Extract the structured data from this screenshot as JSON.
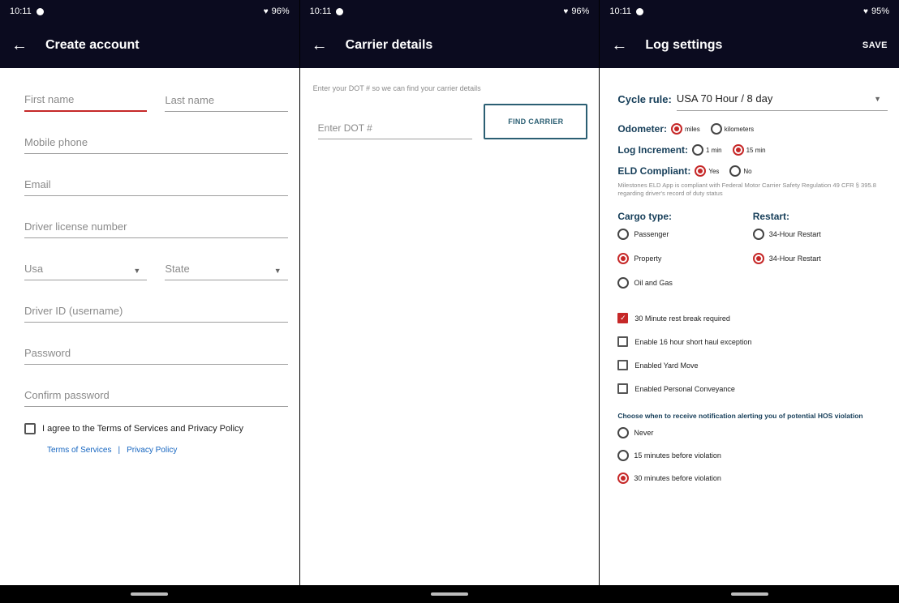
{
  "status": {
    "time": "10:11",
    "battery": "96%",
    "battery3": "95%"
  },
  "screens": {
    "create_account": {
      "title": "Create account",
      "fields": {
        "first_name": "First name",
        "last_name": "Last name",
        "mobile_phone": "Mobile phone",
        "email": "Email",
        "driver_license": "Driver license number",
        "country": "Usa",
        "state": "State",
        "driver_id": "Driver ID (username)",
        "password": "Password",
        "confirm_password": "Confirm password"
      },
      "agree_text": "I agree to the Terms of Services and Privacy Policy",
      "links": {
        "terms": "Terms of Services",
        "privacy": "Privacy Policy"
      }
    },
    "carrier": {
      "title": "Carrier details",
      "hint": "Enter your DOT # so we can find your carrier details",
      "dot_placeholder": "Enter DOT #",
      "find_button": "FIND CARRIER"
    },
    "log_settings": {
      "title": "Log settings",
      "save": "SAVE",
      "cycle_rule_label": "Cycle rule:",
      "cycle_rule_value": "USA 70 Hour / 8 day",
      "odometer": {
        "label": "Odometer:",
        "options": [
          "miles",
          "kilometers"
        ],
        "selected": "miles"
      },
      "increment": {
        "label": "Log Increment:",
        "options": [
          "1 min",
          "15 min"
        ],
        "selected": "15 min"
      },
      "eld": {
        "label": "ELD Compliant:",
        "options": [
          "Yes",
          "No"
        ],
        "selected": "Yes"
      },
      "eld_note": "Milestones ELD App is compliant with Federal Motor Carrier Safety Regulation 49 CFR § 395.8 regarding driver's record of duty status",
      "cargo": {
        "label": "Cargo type:",
        "options": [
          "Passenger",
          "Property",
          "Oil and Gas"
        ],
        "selected": "Property"
      },
      "restart": {
        "label": "Restart:",
        "options": [
          "34-Hour Restart",
          "34-Hour Restart"
        ],
        "selected_index": 1
      },
      "checks": [
        {
          "label": "30 Minute rest break required",
          "checked": true
        },
        {
          "label": "Enable 16 hour short haul exception",
          "checked": false
        },
        {
          "label": "Enabled Yard Move",
          "checked": false
        },
        {
          "label": "Enabled Personal Conveyance",
          "checked": false
        }
      ],
      "notif_title": "Choose when to receive notification alerting you of potential HOS violation",
      "notif_options": [
        "Never",
        "15 minutes before violation",
        "30 minutes before violation"
      ],
      "notif_selected": "30 minutes before violation"
    }
  }
}
